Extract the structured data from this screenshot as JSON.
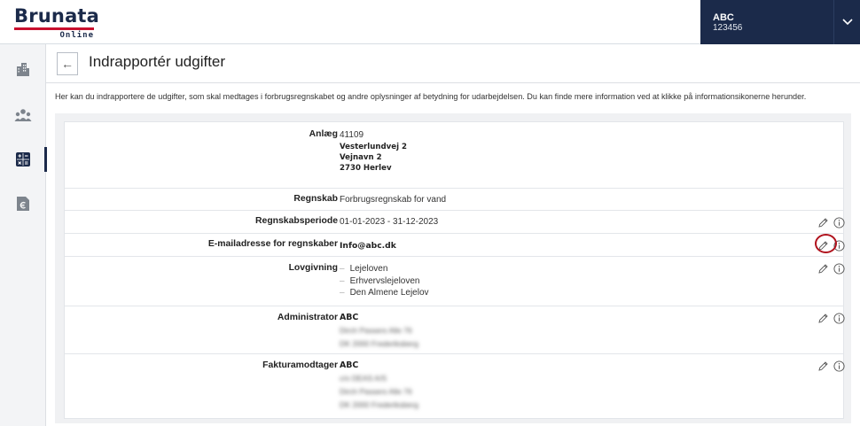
{
  "header": {
    "logo_main": "Brunata",
    "logo_sub": "Online",
    "account_name": "ABC",
    "account_number": "123456"
  },
  "sidebar": {
    "items": [
      {
        "icon": "building-icon",
        "active": false
      },
      {
        "icon": "people-icon",
        "active": false
      },
      {
        "icon": "calculator-icon",
        "active": true
      },
      {
        "icon": "document-euro-icon",
        "active": false
      }
    ]
  },
  "page": {
    "title": "Indrapportér udgifter",
    "intro": "Her kan du indrapportere de udgifter, som skal medtages i forbrugsregnskabet og andre oplysninger af betydning for udarbejdelsen. Du kan finde mere information ved at klikke på informationsikonerne herunder."
  },
  "details": {
    "anlaeg": {
      "label": "Anlæg",
      "number": "41109",
      "address": [
        "Vesterlundvej 2",
        "Vejnavn 2",
        "2730 Herlev"
      ]
    },
    "regnskab": {
      "label": "Regnskab",
      "value": "Forbrugsregnskab for vand"
    },
    "periode": {
      "label": "Regnskabsperiode",
      "value": "01-01-2023 - 31-12-2023"
    },
    "email": {
      "label": "E-mailadresse for regnskaber",
      "value": "Info@abc.dk"
    },
    "lovgivning": {
      "label": "Lovgivning",
      "items": [
        "Lejeloven",
        "Erhvervslejeloven",
        "Den Almene Lejelov"
      ]
    },
    "administrator": {
      "label": "Administrator",
      "name": "ABC",
      "lines": [
        "Dirch Passers Alle 76",
        "DK 2000 Frederiksberg"
      ]
    },
    "fakturamodtager": {
      "label": "Fakturamodtager",
      "name": "ABC",
      "lines": [
        "c/o DEAS A/S",
        "Dirch Passers Alle 76",
        "DK 2000 Frederiksberg"
      ]
    }
  },
  "colors": {
    "brand_navy": "#1b2a4a",
    "brand_red": "#c8102e",
    "highlight_ring": "#b0121d"
  }
}
